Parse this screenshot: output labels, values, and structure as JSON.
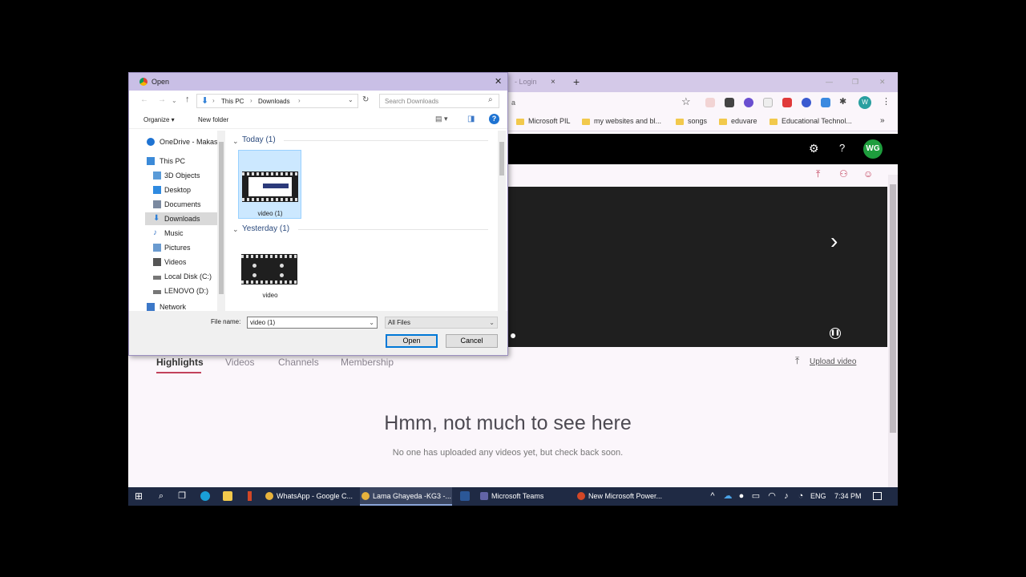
{
  "browser": {
    "tab_label": "- Login",
    "tab_close": "×",
    "new_tab": "+",
    "address_partial": "a",
    "window_min": "—",
    "window_max": "❐",
    "window_close": "✕",
    "bookmarks": [
      "Microsoft PIL",
      "my websites and bl...",
      "songs",
      "eduvare",
      "Educational Technol..."
    ],
    "bookmarks_more": "»",
    "avatar_initials": "W"
  },
  "stream": {
    "avatar_initials": "WG",
    "tabs": [
      "Highlights",
      "Videos",
      "Channels",
      "Membership"
    ],
    "upload_label": "Upload video",
    "empty_title": "Hmm, not much to see here",
    "empty_subtitle": "No one has uploaded any videos yet, but check back soon."
  },
  "dialog": {
    "title": "Open",
    "close": "✕",
    "breadcrumb": [
      "This PC",
      "Downloads"
    ],
    "search_placeholder": "Search Downloads",
    "organize_label": "Organize ▾",
    "new_folder_label": "New folder",
    "nav_items": [
      {
        "label": "OneDrive - Makas",
        "icon": "cloud-icon",
        "color": "#1e73d2"
      },
      {
        "label": "This PC",
        "icon": "computer-icon",
        "color": "#3c8ad8"
      },
      {
        "label": "3D Objects",
        "icon": "cube-icon",
        "color": "#5a9bd8"
      },
      {
        "label": "Desktop",
        "icon": "desktop-icon",
        "color": "#2f8ae0"
      },
      {
        "label": "Documents",
        "icon": "document-icon",
        "color": "#7b8aa0"
      },
      {
        "label": "Downloads",
        "icon": "download-icon",
        "color": "#2e7fd6"
      },
      {
        "label": "Music",
        "icon": "music-icon",
        "color": "#3c78c8"
      },
      {
        "label": "Pictures",
        "icon": "picture-icon",
        "color": "#6a9bd0"
      },
      {
        "label": "Videos",
        "icon": "video-icon",
        "color": "#555"
      },
      {
        "label": "Local Disk (C:)",
        "icon": "drive-icon",
        "color": "#777"
      },
      {
        "label": "LENOVO (D:)",
        "icon": "drive-icon",
        "color": "#777"
      },
      {
        "label": "Network",
        "icon": "network-icon",
        "color": "#3c78c8"
      }
    ],
    "groups": [
      {
        "header": "Today (1)",
        "file": "video (1)"
      },
      {
        "header": "Yesterday (1)",
        "file": "video"
      }
    ],
    "filename_label": "File name:",
    "filename_value": "video (1)",
    "filetype_value": "All Files",
    "open_label": "Open",
    "cancel_label": "Cancel"
  },
  "taskbar": {
    "tasks": [
      {
        "label": "WhatsApp - Google C...",
        "icon_color": "#e8b33c"
      },
      {
        "label": "Lama Ghayeda -KG3 -...",
        "icon_color": "#e8b33c"
      },
      {
        "label": "Microsoft Teams",
        "icon_color": "#6264a7"
      },
      {
        "label": "New Microsoft Power...",
        "icon_color": "#d24726"
      }
    ],
    "lang": "ENG",
    "time": "7:34 PM"
  }
}
